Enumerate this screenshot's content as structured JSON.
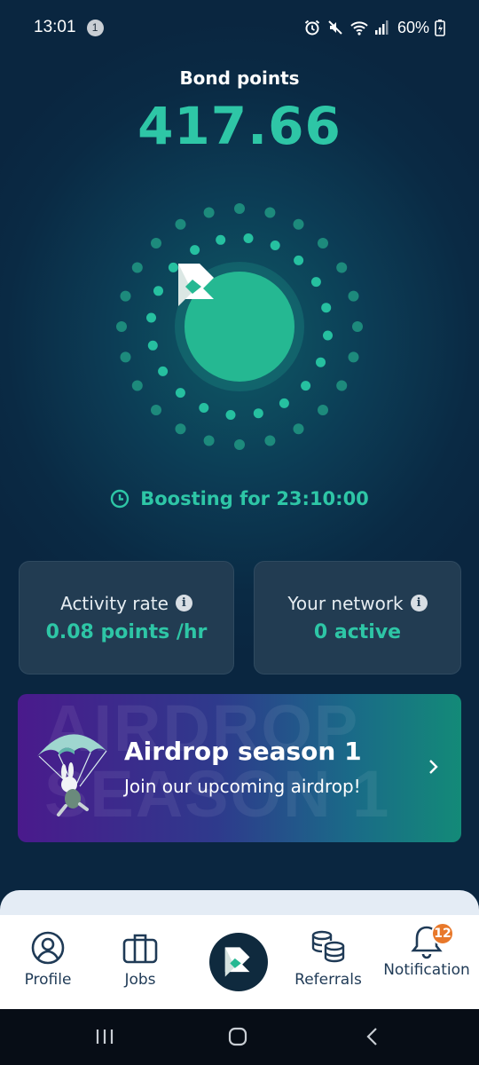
{
  "status_bar": {
    "time": "13:01",
    "notification_count": "1",
    "battery": "60%"
  },
  "points": {
    "label": "Bond points",
    "value": "417.66"
  },
  "boost": {
    "text": "Boosting for 23:10:00"
  },
  "cards": [
    {
      "title": "Activity rate",
      "value": "0.08 points /hr"
    },
    {
      "title": "Your network",
      "value": "0 active"
    }
  ],
  "airdrop": {
    "watermark_line1": "AIRDROP",
    "watermark_line2": "SEASON 1",
    "title": "Airdrop season 1",
    "subtitle": "Join our upcoming airdrop!"
  },
  "nav": {
    "profile": "Profile",
    "jobs": "Jobs",
    "referrals": "Referrals",
    "notification": "Notification",
    "notification_badge": "12"
  },
  "colors": {
    "accent": "#2ec6a6",
    "background": "#0a2a44",
    "card": "#223c52",
    "badge": "#e8782a"
  }
}
